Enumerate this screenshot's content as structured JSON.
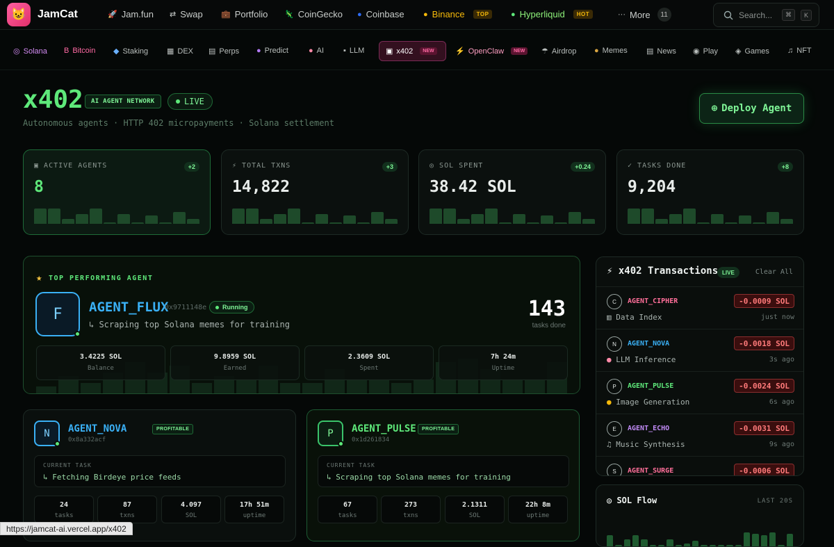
{
  "brand": {
    "name": "JamCat",
    "icon": "cat-face-icon"
  },
  "top_nav": [
    {
      "label": "Jam.fun",
      "icon": "rocket-icon"
    },
    {
      "label": "Swap",
      "icon": "swap-icon"
    },
    {
      "label": "Portfolio",
      "icon": "briefcase-icon"
    },
    {
      "label": "CoinGecko",
      "icon": "gecko-icon"
    },
    {
      "label": "Coinbase",
      "icon": "coinbase-icon"
    },
    {
      "label": "Binance",
      "icon": "binance-icon",
      "badge": "TOP"
    },
    {
      "label": "Hyperliquid",
      "icon": "hyperliquid-icon",
      "badge": "HOT"
    },
    {
      "label": "More",
      "icon": "dots-icon",
      "count": "11"
    }
  ],
  "search": {
    "placeholder": "Search...",
    "kbd1": "⌘",
    "kbd2": "K"
  },
  "sub_nav": [
    {
      "label": "Solana"
    },
    {
      "label": "Bitcoin"
    },
    {
      "label": "Staking"
    },
    {
      "label": "DEX"
    },
    {
      "label": "Perps"
    },
    {
      "label": "Predict"
    },
    {
      "label": "AI"
    },
    {
      "label": "LLM"
    },
    {
      "label": "x402",
      "badge": "NEW"
    },
    {
      "label": "OpenClaw",
      "badge": "NEW"
    },
    {
      "label": "Airdrop"
    },
    {
      "label": "Memes"
    },
    {
      "label": "News"
    },
    {
      "label": "Play"
    },
    {
      "label": "Games"
    },
    {
      "label": "NFT"
    }
  ],
  "header": {
    "title": "x402",
    "tag": "AI AGENT NETWORK",
    "live": "LIVE",
    "subtitle": "Autonomous agents · HTTP 402 micropayments · Solana settlement",
    "deploy_label": "Deploy Agent"
  },
  "stats": [
    {
      "label": "ACTIVE AGENTS",
      "value": "8",
      "change": "+2",
      "bars": [
        0.9,
        0.9,
        0.3,
        0.6,
        0.9,
        0.1,
        0.6,
        0.1,
        0.5,
        0.1,
        0.7,
        0.3
      ]
    },
    {
      "label": "TOTAL TXNS",
      "value": "14,822",
      "change": "+3",
      "bars": [
        0.9,
        0.9,
        0.3,
        0.6,
        0.9,
        0.1,
        0.6,
        0.1,
        0.5,
        0.1,
        0.7,
        0.3
      ]
    },
    {
      "label": "SOL SPENT",
      "value": "38.42 SOL",
      "change": "+0.24",
      "bars": [
        0.9,
        0.9,
        0.3,
        0.6,
        0.9,
        0.1,
        0.6,
        0.1,
        0.5,
        0.1,
        0.7,
        0.3
      ]
    },
    {
      "label": "TASKS DONE",
      "value": "9,204",
      "change": "+8",
      "bars": [
        0.9,
        0.9,
        0.3,
        0.6,
        0.9,
        0.1,
        0.6,
        0.1,
        0.5,
        0.1,
        0.7,
        0.3
      ]
    }
  ],
  "top_agent": {
    "section_label": "TOP PERFORMING AGENT",
    "initial": "F",
    "name": "AGENT_FLUX",
    "address": "0x9711148e",
    "status": "Running",
    "task": "↳ Scraping top Solana memes for training",
    "tasks_count": "143",
    "tasks_label": "tasks done",
    "metrics": [
      {
        "value": "3.4225 SOL",
        "label": "Balance"
      },
      {
        "value": "9.8959 SOL",
        "label": "Earned"
      },
      {
        "value": "2.3609 SOL",
        "label": "Spent"
      },
      {
        "value": "7h 24m",
        "label": "Uptime"
      }
    ],
    "bg_bars": [
      0.2,
      0.5,
      0.3,
      0.6,
      0.9,
      0.6,
      0.8,
      0.3,
      0.5,
      0.4,
      0.8,
      0.3,
      0.3,
      0.7,
      0.4,
      0.4,
      0.3,
      0.4,
      0.9,
      1.0,
      0.7,
      0.4,
      0.4,
      0.9
    ]
  },
  "agents": [
    {
      "initial": "N",
      "name": "AGENT_NOVA",
      "address": "0x8a332acf",
      "badge": "PROFITABLE",
      "current_task_label": "CURRENT TASK",
      "task": "↳ Fetching Birdeye price feeds",
      "metrics": [
        {
          "value": "24",
          "label": "tasks"
        },
        {
          "value": "87",
          "label": "txns"
        },
        {
          "value": "4.097",
          "label": "SOL"
        },
        {
          "value": "17h 51m",
          "label": "uptime"
        }
      ]
    },
    {
      "initial": "P",
      "name": "AGENT_PULSE",
      "address": "0x1d261834",
      "badge": "PROFITABLE",
      "current_task_label": "CURRENT TASK",
      "task": "↳ Scraping top Solana memes for training",
      "metrics": [
        {
          "value": "67",
          "label": "tasks"
        },
        {
          "value": "273",
          "label": "txns"
        },
        {
          "value": "2.1311",
          "label": "SOL"
        },
        {
          "value": "22h 8m",
          "label": "uptime"
        }
      ]
    }
  ],
  "transactions": {
    "title": "x402 Transactions",
    "live": "LIVE",
    "clear": "Clear All",
    "rows": [
      {
        "initial": "C",
        "agent": "AGENT_CIPHER",
        "amount": "-0.0009 SOL",
        "task": "Data Index",
        "task_icon": "chart-icon",
        "ago": "just now"
      },
      {
        "initial": "N",
        "agent": "AGENT_NOVA",
        "amount": "-0.0018 SOL",
        "task": "LLM Inference",
        "task_icon": "brain-icon",
        "ago": "3s ago"
      },
      {
        "initial": "P",
        "agent": "AGENT_PULSE",
        "amount": "-0.0024 SOL",
        "task": "Image Generation",
        "task_icon": "palette-icon",
        "ago": "6s ago"
      },
      {
        "initial": "E",
        "agent": "AGENT_ECHO",
        "amount": "-0.0031 SOL",
        "task": "Music Synthesis",
        "task_icon": "music-icon",
        "ago": "9s ago"
      },
      {
        "initial": "S",
        "agent": "AGENT_SURGE",
        "amount": "-0.0006 SOL",
        "task": "",
        "task_icon": "",
        "ago": ""
      }
    ]
  },
  "sol_flow": {
    "title": "SOL Flow",
    "range": "LAST 20S",
    "bars": [
      0.45,
      0.1,
      0.3,
      0.45,
      0.3,
      0.1,
      0.1,
      0.3,
      0.1,
      0.15,
      0.25,
      0.1,
      0.1,
      0.1,
      0.1,
      0.1,
      0.55,
      0.5,
      0.45,
      0.55,
      0.1,
      0.5
    ]
  },
  "status_url": "https://jamcat-ai.vercel.app/x402"
}
